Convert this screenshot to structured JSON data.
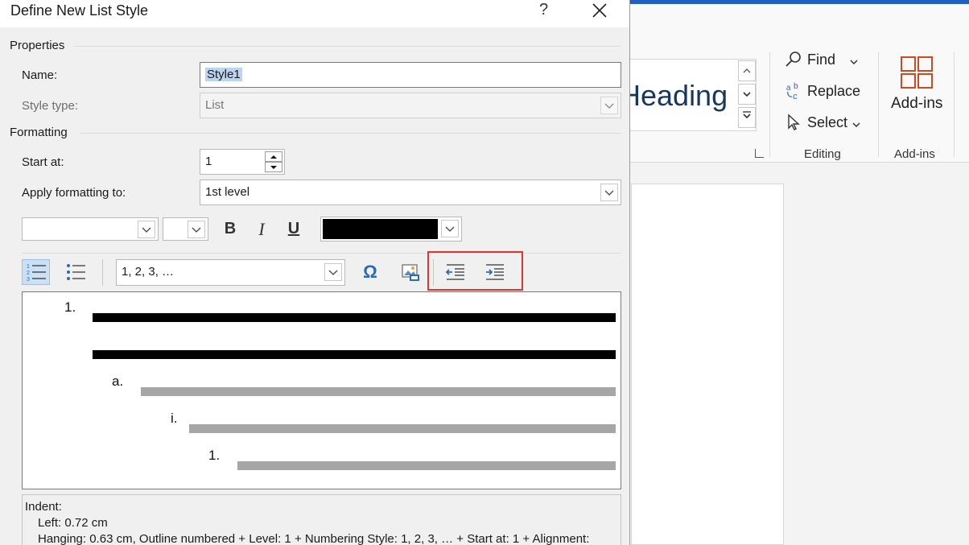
{
  "word": {
    "gallery_style_text": "Heading",
    "editing_group": {
      "label": "Editing",
      "find_label": "Find",
      "replace_label": "Replace",
      "select_label": "Select"
    },
    "addins_group": {
      "label": "Add-ins",
      "button_label": "Add-ins"
    }
  },
  "dialog": {
    "title": "Define New List Style",
    "help_glyph": "?",
    "close_glyph": "✕",
    "properties": {
      "section_label": "Properties",
      "name_label": "Name:",
      "name_value": "Style1",
      "style_type_label": "Style type:",
      "style_type_value": "List"
    },
    "formatting": {
      "section_label": "Formatting",
      "start_at_label": "Start at:",
      "start_at_value": "1",
      "apply_to_label": "Apply formatting to:",
      "apply_to_value": "1st level",
      "font_value": "",
      "size_value": "",
      "bold_glyph": "B",
      "italic_glyph": "I",
      "underline_glyph": "U",
      "font_color": "#000000",
      "numbering_style_value": "1, 2, 3, …",
      "symbol_glyph": "Ω"
    },
    "preview": {
      "level1": "1.",
      "level2": "a.",
      "level3": "i.",
      "level4": "1."
    },
    "description": {
      "line1": "Indent:",
      "line2": "Left:  0.72 cm",
      "line3": "Hanging:  0.63 cm, Outline numbered + Level: 1 + Numbering Style: 1, 2, 3, … + Start at: 1 + Alignment:"
    }
  },
  "colors": {
    "highlight_box": "#e0342d",
    "heading_text": "#17375e",
    "addins_icon": "#d04a1f"
  }
}
